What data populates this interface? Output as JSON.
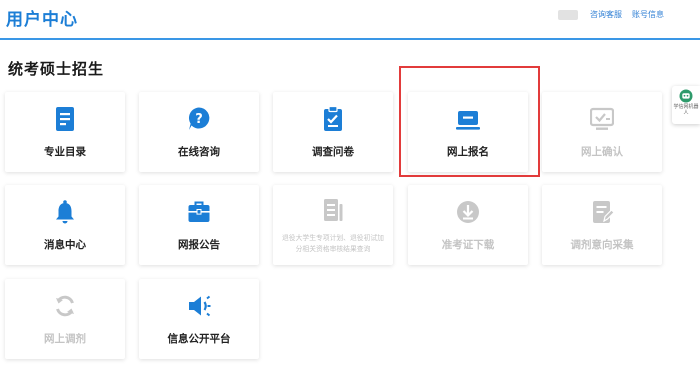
{
  "header": {
    "title": "用户中心",
    "links": {
      "consult": "咨询客服",
      "account": "账号信息"
    }
  },
  "section": {
    "title": "统考硕士招生"
  },
  "colors": {
    "accent": "#1c7ed6",
    "disabled": "#c8c8c8",
    "highlight": "#e23b3b"
  },
  "tiles": [
    {
      "label": "专业目录",
      "icon": "book-icon",
      "enabled": true
    },
    {
      "label": "在线咨询",
      "icon": "question-chat-icon",
      "enabled": true
    },
    {
      "label": "调查问卷",
      "icon": "clipboard-icon",
      "enabled": true
    },
    {
      "label": "网上报名",
      "icon": "laptop-icon",
      "enabled": true
    },
    {
      "label": "网上确认",
      "icon": "screen-check-icon",
      "enabled": false
    },
    {
      "label": "消息中心",
      "icon": "bell-icon",
      "enabled": true
    },
    {
      "label": "网报公告",
      "icon": "briefcase-icon",
      "enabled": true
    },
    {
      "label": "退役大学生专项计划、退役初试加分相关资格审核结果查询",
      "icon": "document-list-icon",
      "enabled": false
    },
    {
      "label": "准考证下载",
      "icon": "download-icon",
      "enabled": false
    },
    {
      "label": "调剂意向采集",
      "icon": "form-edit-icon",
      "enabled": false
    },
    {
      "label": "网上调剂",
      "icon": "refresh-icon",
      "enabled": false
    },
    {
      "label": "信息公开平台",
      "icon": "megaphone-icon",
      "enabled": true
    }
  ],
  "widget": {
    "label": "学信网机器人",
    "icon": "robot-icon"
  }
}
